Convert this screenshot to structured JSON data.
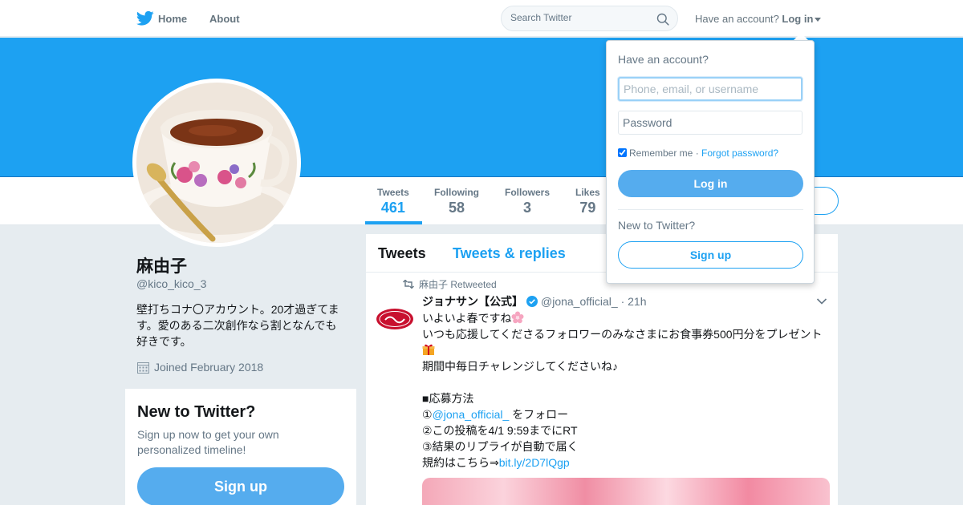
{
  "nav": {
    "home": "Home",
    "about": "About",
    "search_placeholder": "Search Twitter",
    "have_account": "Have an account?",
    "login": "Log in"
  },
  "profile": {
    "name": "麻由子",
    "handle": "@kico_kico_3",
    "bio": "壁打ちコナ〇アカウント。20才過ぎてます。愛のある二次創作なら割となんでも好きです。",
    "joined": "Joined February 2018"
  },
  "stats": [
    {
      "label": "Tweets",
      "value": "461"
    },
    {
      "label": "Following",
      "value": "58"
    },
    {
      "label": "Followers",
      "value": "3"
    },
    {
      "label": "Likes",
      "value": "79"
    }
  ],
  "side_card": {
    "title": "New to Twitter?",
    "subtitle": "Sign up now to get your own personalized timeline!",
    "signup": "Sign up"
  },
  "timeline": {
    "tabs": [
      "Tweets",
      "Tweets & replies"
    ],
    "tweet": {
      "retweeted_by": "麻由子 Retweeted",
      "name": "ジョナサン【公式】",
      "handle": "@jona_official_",
      "time": "· 21h",
      "lines": [
        "いよいよ春ですね",
        "いつも応援してくださるフォロワーのみなさまにお食事券500円分をプレゼント",
        "期間中毎日チャレンジしてくださいね♪",
        "",
        "■応募方法",
        "①",
        "②この投稿を4/1 9:59までにRT",
        "③結果のリプライが自動で届く",
        "規約はこちら⇒"
      ],
      "mention": "@jona_official_",
      "mention_suffix": " をフォロー",
      "link": "bit.ly/2D7lQgp"
    }
  },
  "login_dropdown": {
    "title": "Have an account?",
    "username_placeholder": "Phone, email, or username",
    "password_placeholder": "Password",
    "remember": "Remember me",
    "separator": " · ",
    "forgot": "Forgot password?",
    "login_button": "Log in",
    "new_to_twitter": "New to Twitter?",
    "signup_button": "Sign up"
  },
  "colors": {
    "accent": "#1da1f2",
    "button_blue": "#55acee",
    "background": "#e6ecf0"
  }
}
